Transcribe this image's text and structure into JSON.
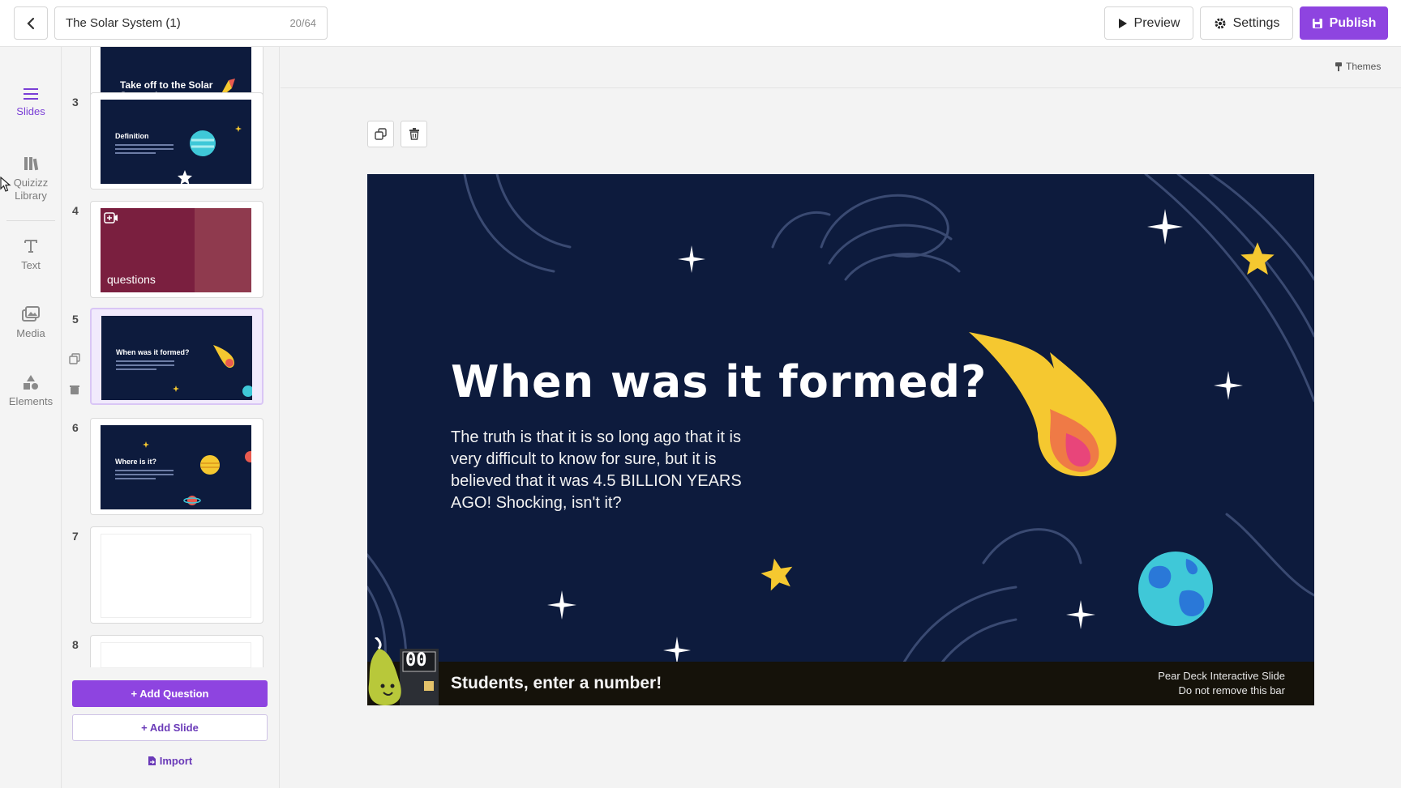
{
  "header": {
    "back_label": "back",
    "title": "The Solar System (1)",
    "slide_count": "20/64",
    "preview_label": "Preview",
    "settings_label": "Settings",
    "publish_label": "Publish"
  },
  "rail": {
    "items": [
      {
        "label": "Slides",
        "icon": "list-icon"
      },
      {
        "label": "Quizizz Library",
        "icon": "library-icon"
      },
      {
        "label": "Text",
        "icon": "text-icon"
      },
      {
        "label": "Media",
        "icon": "media-icon"
      },
      {
        "label": "Elements",
        "icon": "shapes-icon"
      }
    ]
  },
  "slides": {
    "items": [
      {
        "num": "",
        "title": "Take off to the Solar System!"
      },
      {
        "num": "3",
        "title": "Definition"
      },
      {
        "num": "4",
        "title": "questions"
      },
      {
        "num": "5",
        "title": "When was it formed?"
      },
      {
        "num": "6",
        "title": "Where is it?"
      },
      {
        "num": "7",
        "title": ""
      },
      {
        "num": "8",
        "title": ""
      }
    ],
    "add_question_label": "+ Add Question",
    "add_slide_label": "+ Add Slide",
    "import_label": "Import"
  },
  "canvas": {
    "themes_label": "Themes",
    "slide_title": "When was it formed?",
    "slide_body": "The truth is that it is so long ago that it is very difficult to know for sure, but it is believed that it was 4.5 BILLION YEARS AGO! Shocking, isn't it?",
    "deck_prompt": "Students, enter a number!",
    "deck_note_line1": "Pear Deck Interactive Slide",
    "deck_note_line2": "Do not remove this bar",
    "deck_counter": "00"
  },
  "colors": {
    "accent": "#8e44e0",
    "slide_bg": "#0d1b3d",
    "star": "#f5c830",
    "planet": "#3fc8d8"
  }
}
